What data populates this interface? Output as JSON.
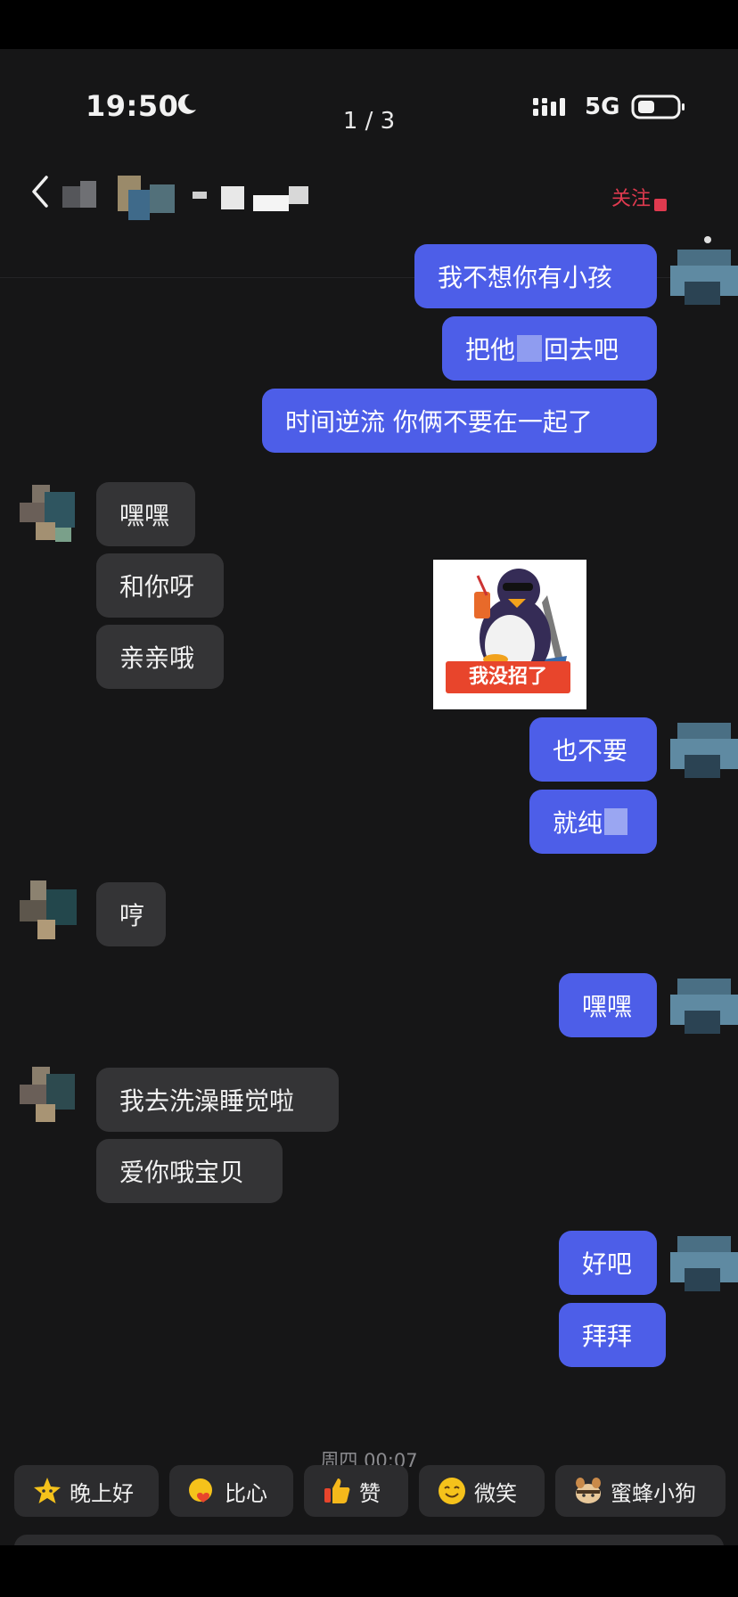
{
  "status_bar": {
    "time": "19:50",
    "page_indicator": "1 / 3",
    "network": "5G",
    "moon_icon": "moon-icon",
    "signal_icon": "signal-icon",
    "battery_icon": "battery-icon"
  },
  "header": {
    "back_icon": "chevron-left-icon",
    "follow_label": "关注",
    "more_icon": "dot-icon"
  },
  "messages": {
    "m1": "我不想你有小孩",
    "m2": "把他",
    "m2b": "回去吧",
    "m3": "时间逆流 你俩不要在一起了",
    "m4": "嘿嘿",
    "m5": "和你呀",
    "m6": "亲亲哦",
    "m7": "也不要",
    "m8": "就纯",
    "m9": "哼",
    "m10": "嘿嘿",
    "m11": "我去洗澡睡觉啦",
    "m12": "爱你哦宝贝",
    "m13": "好吧",
    "m14": "拜拜"
  },
  "sticker": {
    "caption": "我没招了",
    "icon": "penguin-sticker-icon"
  },
  "timestamp": "周四 00:07",
  "quick_replies": [
    {
      "label": "晚上好",
      "icon": "star-emoji-icon"
    },
    {
      "label": "比心",
      "icon": "heart-hands-emoji-icon"
    },
    {
      "label": "赞",
      "icon": "thumbs-up-emoji-icon"
    },
    {
      "label": "微笑",
      "icon": "smile-emoji-icon"
    },
    {
      "label": "蜜蜂小狗",
      "icon": "bee-dog-emoji-icon"
    }
  ],
  "colors": {
    "outgoing_bubble": "#4d5ee8",
    "incoming_bubble": "#343436",
    "background": "#161617",
    "follow_accent": "#e03a4f"
  }
}
